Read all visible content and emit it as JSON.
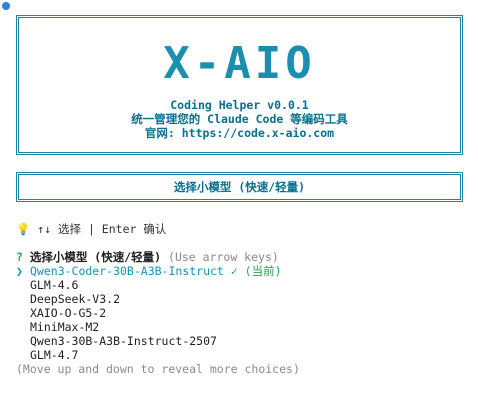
{
  "banner": {
    "logo": "X-AIO",
    "line1": "Coding Helper v0.0.1",
    "line2": "统一管理您的 Claude Code 等编码工具",
    "line3": "官网: https://code.x-aio.com"
  },
  "title": "选择小模型 (快速/轻量)",
  "hint": {
    "icon": "lightbulb-icon",
    "text": "↑↓ 选择 | Enter 确认"
  },
  "prompt": {
    "question_mark": "?",
    "label": "选择小模型 (快速/轻量)",
    "help": "(Use arrow keys)"
  },
  "options": [
    {
      "pointer": "❯",
      "label": "Qwen3-Coder-30B-A3B-Instruct",
      "current": "✓ (当前)",
      "selected": true
    },
    {
      "pointer": "",
      "label": "GLM-4.6",
      "current": "",
      "selected": false
    },
    {
      "pointer": "",
      "label": "DeepSeek-V3.2",
      "current": "",
      "selected": false
    },
    {
      "pointer": "",
      "label": "XAIO-O-G5-2",
      "current": "",
      "selected": false
    },
    {
      "pointer": "",
      "label": "MiniMax-M2",
      "current": "",
      "selected": false
    },
    {
      "pointer": "",
      "label": "Qwen3-30B-A3B-Instruct-2507",
      "current": "",
      "selected": false
    },
    {
      "pointer": "",
      "label": "GLM-4.7",
      "current": "",
      "selected": false
    }
  ],
  "footer": "(Move up and down to reveal more choices)",
  "colors": {
    "accent": "#1e85a3",
    "selected": "#1592b8",
    "question": "#2aa34a",
    "muted": "#8a8a8a"
  }
}
